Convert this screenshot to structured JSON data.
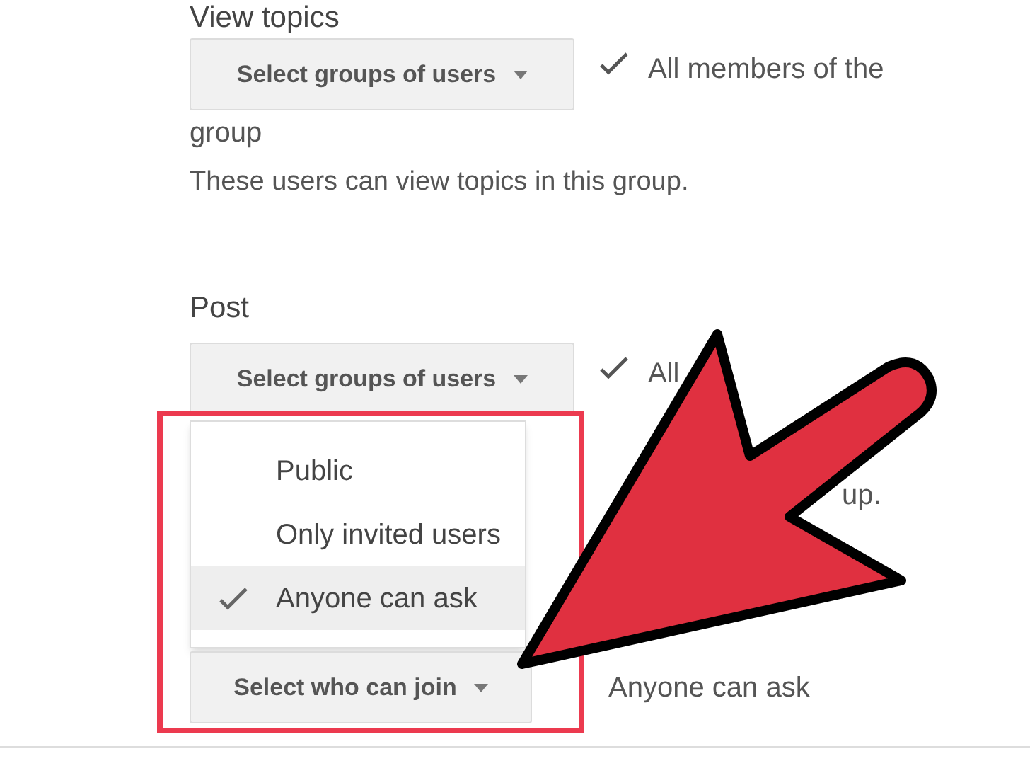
{
  "view_topics": {
    "heading": "View topics",
    "button": "Select groups of users",
    "value_lines": [
      "All members of the",
      "group"
    ],
    "description": "These users can view topics in this group."
  },
  "post": {
    "heading": "Post",
    "button": "Select groups of users",
    "value": "All",
    "tail": "up."
  },
  "join": {
    "menu": [
      {
        "label": "Public",
        "selected": false
      },
      {
        "label": "Only invited users",
        "selected": false
      },
      {
        "label": "Anyone can ask",
        "selected": true
      }
    ],
    "button": "Select who can join",
    "value": "Anyone can ask"
  }
}
